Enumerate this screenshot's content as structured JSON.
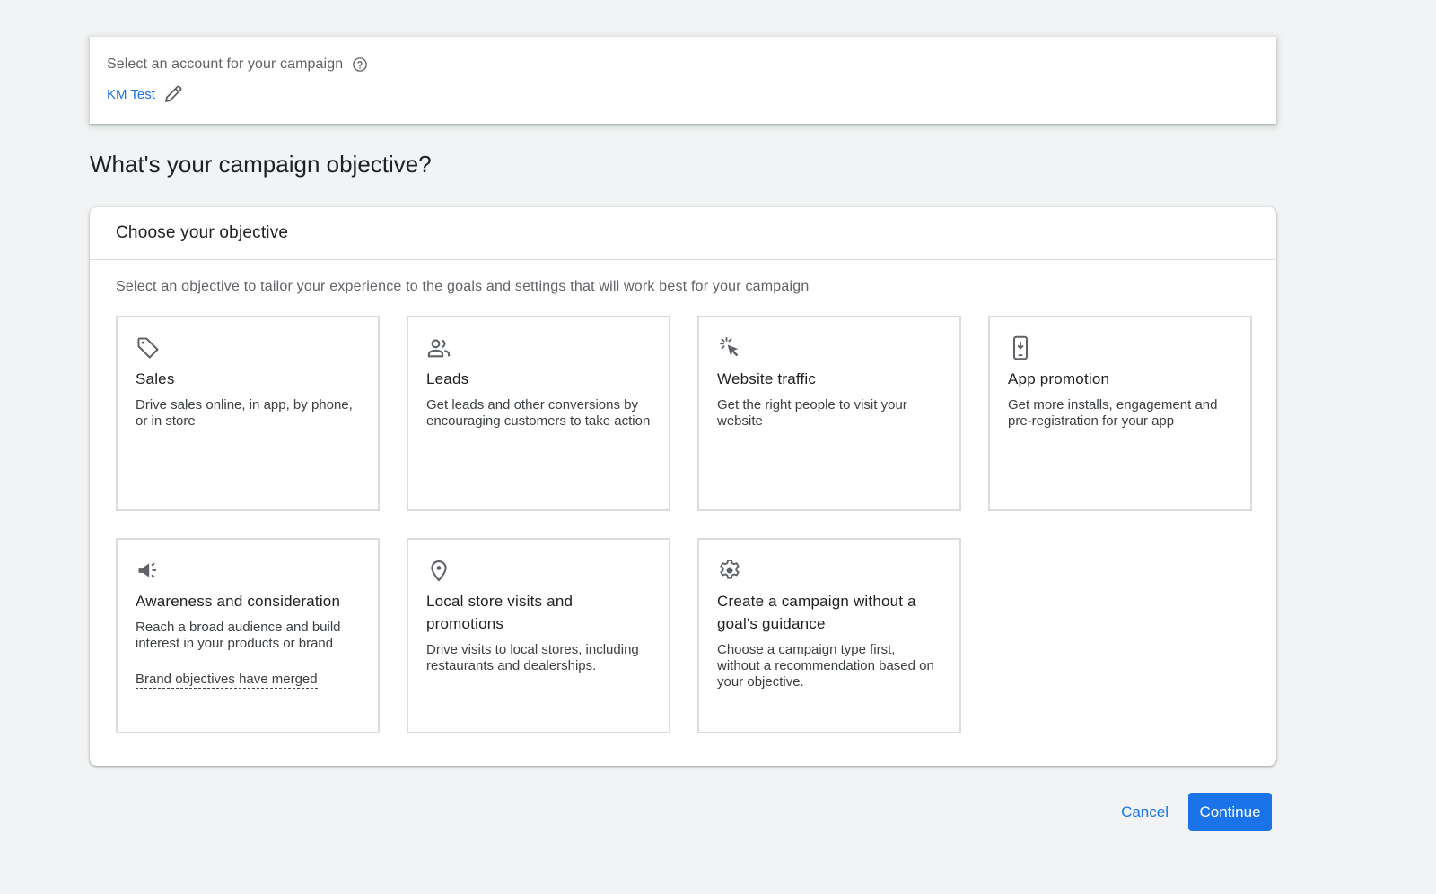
{
  "account": {
    "label": "Select an account for your campaign",
    "help_icon": "help-circle-icon",
    "name": "KM Test",
    "edit_icon": "pencil-icon"
  },
  "page": {
    "title": "What's your campaign objective?"
  },
  "panel": {
    "title": "Choose your objective",
    "description": "Select an objective to tailor your experience to the goals and settings that will work best for your campaign",
    "objectives": [
      {
        "icon": "tag-icon",
        "title": "Sales",
        "description": "Drive sales online, in app, by phone, or in store"
      },
      {
        "icon": "people-icon",
        "title": "Leads",
        "description": "Get leads and other conversions by encouraging customers to take action"
      },
      {
        "icon": "cursor-click-icon",
        "title": "Website traffic",
        "description": "Get the right people to visit your website"
      },
      {
        "icon": "phone-download-icon",
        "title": "App promotion",
        "description": "Get more installs, engagement and pre-registration for your app"
      },
      {
        "icon": "megaphone-icon",
        "title": "Awareness and consideration",
        "description": "Reach a broad audience and build interest in your products or brand",
        "link": "Brand objectives have merged"
      },
      {
        "icon": "location-pin-icon",
        "title": "Local store visits and promotions",
        "description": "Drive visits to local stores, including restaurants and dealerships."
      },
      {
        "icon": "gear-icon",
        "title": "Create a campaign without a goal's guidance",
        "description": "Choose a campaign type first, without a recommendation based on your objective."
      }
    ]
  },
  "actions": {
    "cancel_label": "Cancel",
    "continue_label": "Continue"
  },
  "colors": {
    "accent": "#1a73e8",
    "background": "#f1f3f4",
    "border": "#dadce0"
  }
}
